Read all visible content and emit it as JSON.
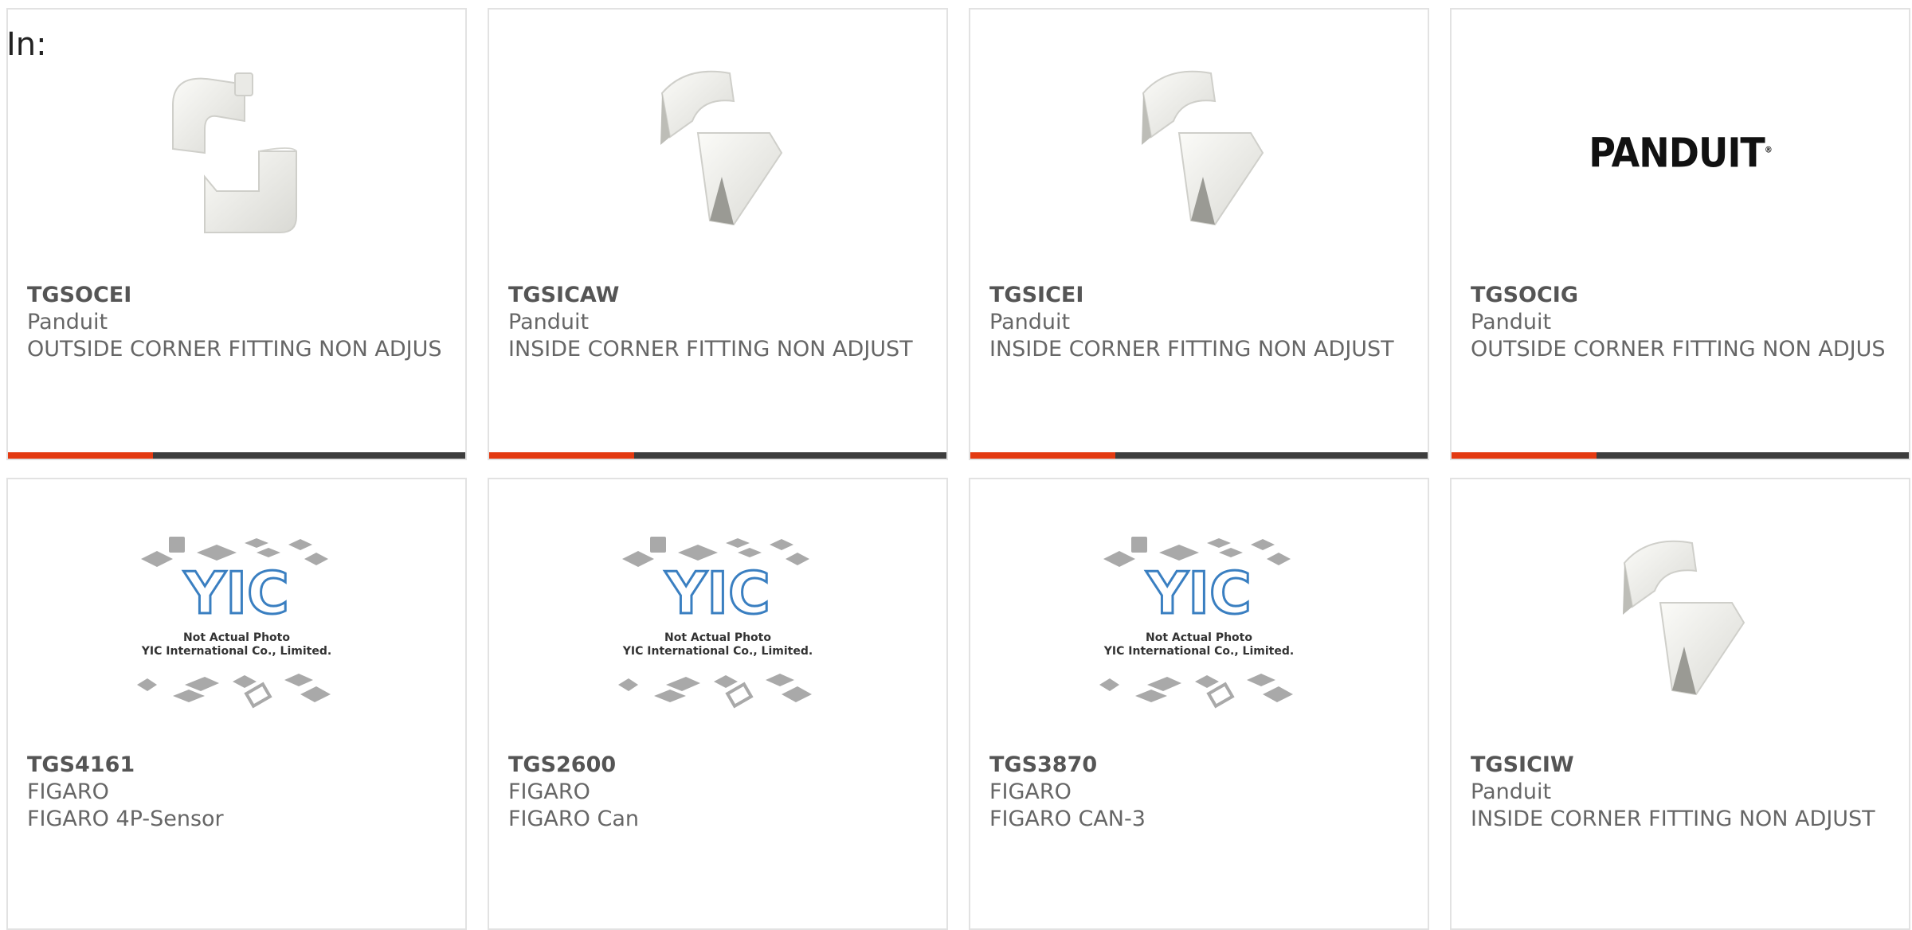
{
  "header": {
    "label": "In:"
  },
  "colors": {
    "accent": "#e33a12",
    "bar": "#3d3d3d",
    "border": "#e2e2e2"
  },
  "products": [
    {
      "part": "TGSOCEI",
      "manufacturer": "Panduit",
      "description": "OUTSIDE CORNER FITTING NON ADJUS",
      "image": "outside-corner-fitting"
    },
    {
      "part": "TGSICAW",
      "manufacturer": "Panduit",
      "description": "INSIDE CORNER FITTING NON ADJUST",
      "image": "inside-corner-fitting"
    },
    {
      "part": "TGSICEI",
      "manufacturer": "Panduit",
      "description": "INSIDE CORNER FITTING NON ADJUST",
      "image": "inside-corner-fitting"
    },
    {
      "part": "TGSOCIG",
      "manufacturer": "Panduit",
      "description": "OUTSIDE CORNER FITTING NON ADJUS",
      "image": "panduit-logo",
      "logo_text": "PANDUIT"
    },
    {
      "part": "TGS4161",
      "manufacturer": "FIGARO",
      "description": "FIGARO 4P-Sensor",
      "image": "not-actual-photo-placeholder"
    },
    {
      "part": "TGS2600",
      "manufacturer": "FIGARO",
      "description": "FIGARO Can",
      "image": "not-actual-photo-placeholder"
    },
    {
      "part": "TGS3870",
      "manufacturer": "FIGARO",
      "description": "FIGARO CAN-3",
      "image": "not-actual-photo-placeholder"
    },
    {
      "part": "TGSICIW",
      "manufacturer": "Panduit",
      "description": "INSIDE CORNER FITTING NON ADJUST",
      "image": "inside-corner-fitting"
    }
  ],
  "placeholder": {
    "logo_text": "YIC",
    "line1": "Not Actual Photo",
    "line2": "YIC International Co., Limited."
  }
}
